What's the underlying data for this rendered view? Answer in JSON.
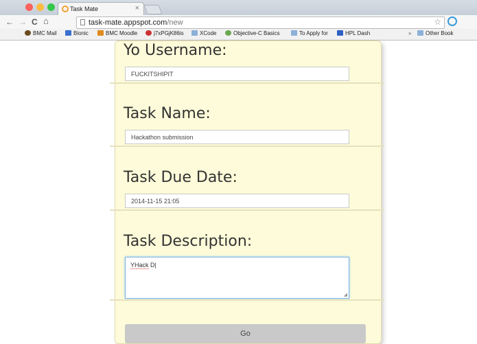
{
  "browser": {
    "tab_title": "Task Mate",
    "tab_close": "×",
    "url_host": "task-mate.appspot.com",
    "url_path": "/new",
    "nav": {
      "back": "←",
      "forward": "→",
      "reload": "C",
      "home": "⌂"
    },
    "bookmarks": [
      {
        "label": "BMC Mail",
        "icon": "owl-icon"
      },
      {
        "label": "Bionic",
        "icon": "b-icon"
      },
      {
        "label": "BMC Moodle",
        "icon": "moodle-icon"
      },
      {
        "label": "j7xPGjK86is",
        "icon": "video-icon"
      },
      {
        "label": "XCode",
        "icon": "folder-icon"
      },
      {
        "label": "Objective-C Basics",
        "icon": "gear-icon"
      },
      {
        "label": "To Apply for",
        "icon": "folder-icon"
      },
      {
        "label": "HPL Dash",
        "icon": "grid-icon"
      }
    ],
    "bookmarks_overflow": "»",
    "other_bookmarks": "Other Book"
  },
  "form": {
    "username_label": "Yo Username:",
    "username_value": "FUCKITSHIPIT",
    "task_name_label": "Task Name:",
    "task_name_value": "Hackathon submission",
    "due_date_label": "Task Due Date:",
    "due_date_value": "2014-11-15 21:05",
    "description_label": "Task Description:",
    "description_value_word": "YHack",
    "description_value_rest": " D",
    "submit_label": "Go"
  }
}
